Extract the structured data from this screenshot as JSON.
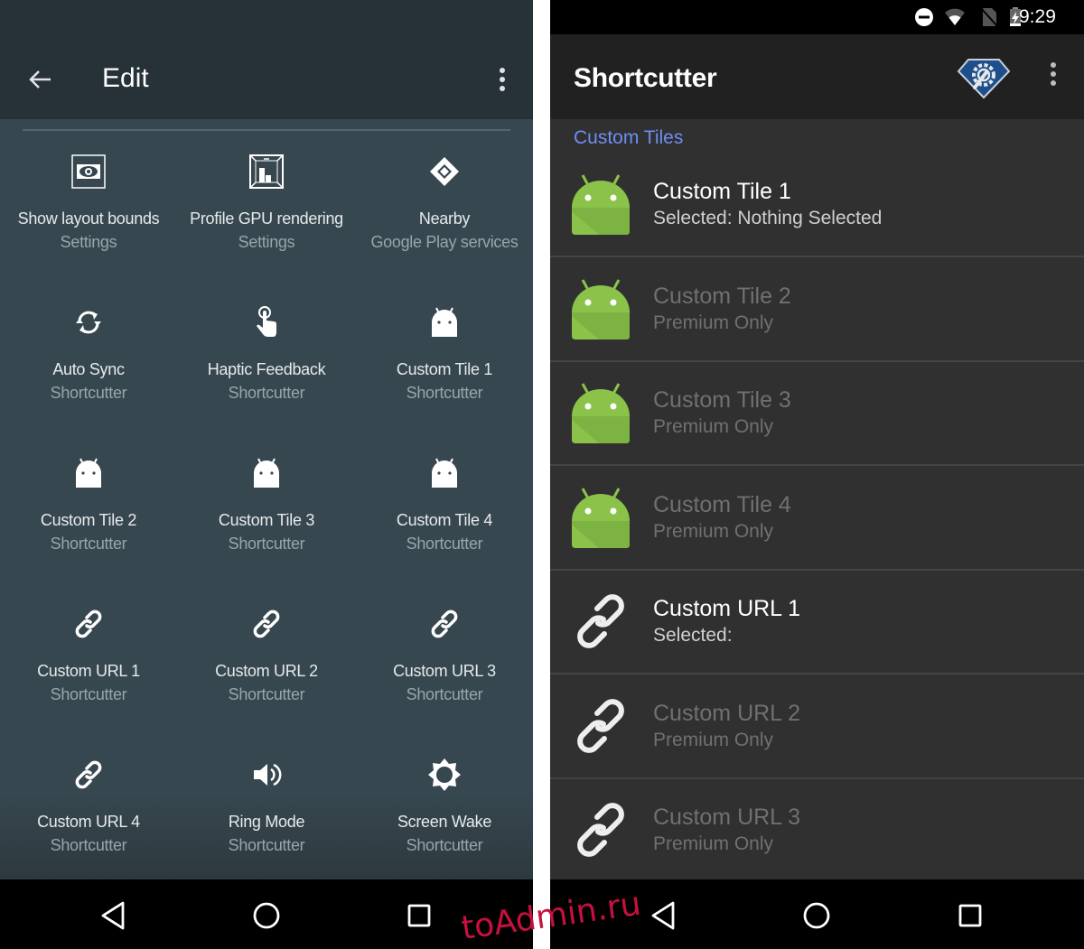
{
  "left": {
    "app_bar": {
      "title": "Edit",
      "back_icon": "arrow-back-icon",
      "overflow_icon": "more-vert-icon"
    },
    "tiles": [
      {
        "name": "Show layout bounds",
        "source": "Settings",
        "icon": "layout-bounds-icon"
      },
      {
        "name": "Profile GPU rendering",
        "source": "Settings",
        "icon": "gpu-profile-icon"
      },
      {
        "name": "Nearby",
        "source": "Google Play services",
        "icon": "nearby-diamond-icon"
      },
      {
        "name": "Auto Sync",
        "source": "Shortcutter",
        "icon": "sync-icon"
      },
      {
        "name": "Haptic Feedback",
        "source": "Shortcutter",
        "icon": "touch-icon"
      },
      {
        "name": "Custom Tile 1",
        "source": "Shortcutter",
        "icon": "android-icon"
      },
      {
        "name": "Custom Tile 2",
        "source": "Shortcutter",
        "icon": "android-icon"
      },
      {
        "name": "Custom Tile 3",
        "source": "Shortcutter",
        "icon": "android-icon"
      },
      {
        "name": "Custom Tile 4",
        "source": "Shortcutter",
        "icon": "android-icon"
      },
      {
        "name": "Custom URL 1",
        "source": "Shortcutter",
        "icon": "link-icon"
      },
      {
        "name": "Custom URL 2",
        "source": "Shortcutter",
        "icon": "link-icon"
      },
      {
        "name": "Custom URL 3",
        "source": "Shortcutter",
        "icon": "link-icon"
      },
      {
        "name": "Custom URL 4",
        "source": "Shortcutter",
        "icon": "link-icon"
      },
      {
        "name": "Ring Mode",
        "source": "Shortcutter",
        "icon": "volume-icon"
      },
      {
        "name": "Screen Wake",
        "source": "Shortcutter",
        "icon": "brightness-icon"
      }
    ]
  },
  "right": {
    "status_bar": {
      "time": "9:29",
      "icons": [
        "do-not-disturb-icon",
        "wifi-icon",
        "no-sim-icon",
        "battery-charging-icon"
      ]
    },
    "app_bar": {
      "title": "Shortcutter",
      "logo_icon": "shortcutter-logo-icon",
      "overflow_icon": "more-vert-icon"
    },
    "section_header": "Custom Tiles",
    "accent_color": "#6e8ef2",
    "items": [
      {
        "title": "Custom Tile 1",
        "subtitle": "Selected: Nothing Selected",
        "icon": "android-icon",
        "enabled": true
      },
      {
        "title": "Custom Tile 2",
        "subtitle": "Premium Only",
        "icon": "android-icon",
        "enabled": false
      },
      {
        "title": "Custom Tile 3",
        "subtitle": "Premium Only",
        "icon": "android-icon",
        "enabled": false
      },
      {
        "title": "Custom Tile 4",
        "subtitle": "Premium Only",
        "icon": "android-icon",
        "enabled": false
      },
      {
        "title": "Custom URL 1",
        "subtitle": "Selected:",
        "icon": "link-icon",
        "enabled": true
      },
      {
        "title": "Custom URL 2",
        "subtitle": "Premium Only",
        "icon": "link-icon",
        "enabled": false
      },
      {
        "title": "Custom URL 3",
        "subtitle": "Premium Only",
        "icon": "link-icon",
        "enabled": false
      }
    ]
  },
  "nav_bar": {
    "back": "nav-back-icon",
    "home": "nav-home-icon",
    "recents": "nav-recents-icon"
  },
  "watermark": "toAdmin.ru"
}
